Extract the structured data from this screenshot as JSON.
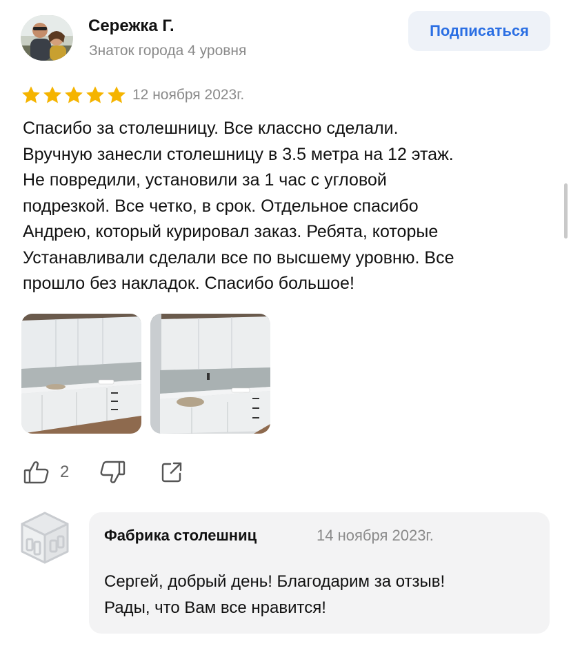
{
  "review": {
    "author_name": "Сережка Г.",
    "author_level": "Знаток города 4 уровня",
    "subscribe_label": "Подписаться",
    "rating": 5,
    "rating_max": 5,
    "date": "12 ноября 2023г.",
    "text_lines": [
      "Спасибо за столешницу. Все классно сделали.",
      "Вручную занесли столешницу в 3.5 метра на 12 этаж.",
      "Не повредили, установили за 1 час с угловой",
      "подрезкой. Все четко, в срок. Отдельное спасибо",
      "Андрею, который курировал заказ. Ребята, которые",
      "Устанавливали сделали все по высшему уровню. Все",
      "прошло без накладок. Спасибо большое!"
    ],
    "likes_count": "2"
  },
  "icons": {
    "like": "thumbs-up-icon",
    "dislike": "thumbs-down-icon",
    "share": "share-icon",
    "star": "star-icon",
    "company_logo": "cube-logo-icon"
  },
  "reply": {
    "author": "Фабрика столешниц",
    "date": "14 ноября 2023г.",
    "text_lines": [
      "Сергей, добрый день! Благодарим за отзыв!",
      "Рады, что Вам все нравится!"
    ]
  },
  "colors": {
    "accent": "#2b6fe3",
    "star": "#f5b400",
    "muted_text": "#8a8a8a",
    "reply_bg": "#f3f3f4"
  }
}
